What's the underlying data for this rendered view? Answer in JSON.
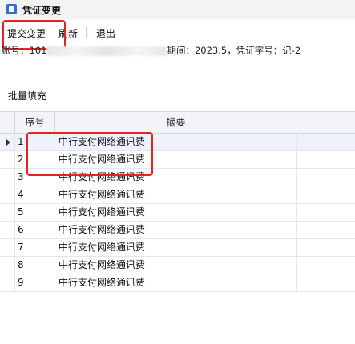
{
  "window": {
    "title": "凭证变更"
  },
  "toolbar": {
    "submit": "提交变更",
    "refresh": "刷新",
    "exit": "退出"
  },
  "info": {
    "account_prefix": "账号：101",
    "period_and_voucher": "期间：2023.5，凭证字号：记-2"
  },
  "batch_fill_label": "批量填充",
  "table": {
    "columns": [
      "序号",
      "摘要"
    ],
    "rows": [
      {
        "no": "1",
        "summary": "中行支付网络通讯费"
      },
      {
        "no": "2",
        "summary": "中行支付网络通讯费"
      },
      {
        "no": "3",
        "summary": "中行支付网络通讯费"
      },
      {
        "no": "4",
        "summary": "中行支付网络通讯费"
      },
      {
        "no": "5",
        "summary": "中行支付网络通讯费"
      },
      {
        "no": "6",
        "summary": "中行支付网络通讯费"
      },
      {
        "no": "7",
        "summary": "中行支付网络通讯费"
      },
      {
        "no": "8",
        "summary": "中行支付网络通讯费"
      },
      {
        "no": "9",
        "summary": "中行支付网络通讯费"
      }
    ]
  },
  "colors": {
    "highlight": "#e8231f",
    "accent": "#2f6fd1"
  }
}
